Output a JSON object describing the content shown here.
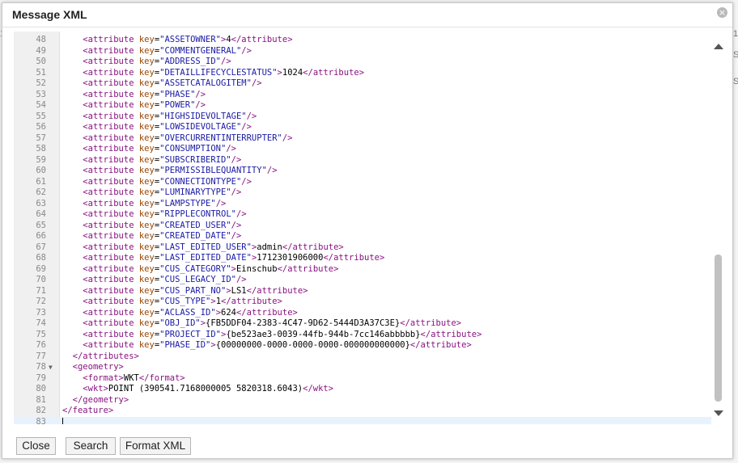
{
  "dialog": {
    "title": "Message XML",
    "close_glyph": "×"
  },
  "background": {
    "left_char_1": "1",
    "right_char_1": "1",
    "right_char_2": "S",
    "right_char_3": "S"
  },
  "editor": {
    "lines": [
      {
        "n": "48",
        "indent": "    ",
        "tag": "attribute",
        "key": "ASSETOWNER",
        "text": "4",
        "selfclose": false
      },
      {
        "n": "49",
        "indent": "    ",
        "tag": "attribute",
        "key": "COMMENTGENERAL",
        "text": "",
        "selfclose": true
      },
      {
        "n": "50",
        "indent": "    ",
        "tag": "attribute",
        "key": "ADDRESS_ID",
        "text": "",
        "selfclose": true
      },
      {
        "n": "51",
        "indent": "    ",
        "tag": "attribute",
        "key": "DETAILLIFECYCLESTATUS",
        "text": "1024",
        "selfclose": false
      },
      {
        "n": "52",
        "indent": "    ",
        "tag": "attribute",
        "key": "ASSETCATALOGITEM",
        "text": "",
        "selfclose": true
      },
      {
        "n": "53",
        "indent": "    ",
        "tag": "attribute",
        "key": "PHASE",
        "text": "",
        "selfclose": true
      },
      {
        "n": "54",
        "indent": "    ",
        "tag": "attribute",
        "key": "POWER",
        "text": "",
        "selfclose": true
      },
      {
        "n": "55",
        "indent": "    ",
        "tag": "attribute",
        "key": "HIGHSIDEVOLTAGE",
        "text": "",
        "selfclose": true
      },
      {
        "n": "56",
        "indent": "    ",
        "tag": "attribute",
        "key": "LOWSIDEVOLTAGE",
        "text": "",
        "selfclose": true
      },
      {
        "n": "57",
        "indent": "    ",
        "tag": "attribute",
        "key": "OVERCURRENTINTERRUPTER",
        "text": "",
        "selfclose": true
      },
      {
        "n": "58",
        "indent": "    ",
        "tag": "attribute",
        "key": "CONSUMPTION",
        "text": "",
        "selfclose": true
      },
      {
        "n": "59",
        "indent": "    ",
        "tag": "attribute",
        "key": "SUBSCRIBERID",
        "text": "",
        "selfclose": true
      },
      {
        "n": "60",
        "indent": "    ",
        "tag": "attribute",
        "key": "PERMISSIBLEQUANTITY",
        "text": "",
        "selfclose": true
      },
      {
        "n": "61",
        "indent": "    ",
        "tag": "attribute",
        "key": "CONNECTIONTYPE",
        "text": "",
        "selfclose": true
      },
      {
        "n": "62",
        "indent": "    ",
        "tag": "attribute",
        "key": "LUMINARYTYPE",
        "text": "",
        "selfclose": true
      },
      {
        "n": "63",
        "indent": "    ",
        "tag": "attribute",
        "key": "LAMPSTYPE",
        "text": "",
        "selfclose": true
      },
      {
        "n": "64",
        "indent": "    ",
        "tag": "attribute",
        "key": "RIPPLECONTROL",
        "text": "",
        "selfclose": true
      },
      {
        "n": "65",
        "indent": "    ",
        "tag": "attribute",
        "key": "CREATED_USER",
        "text": "",
        "selfclose": true
      },
      {
        "n": "66",
        "indent": "    ",
        "tag": "attribute",
        "key": "CREATED_DATE",
        "text": "",
        "selfclose": true
      },
      {
        "n": "67",
        "indent": "    ",
        "tag": "attribute",
        "key": "LAST_EDITED_USER",
        "text": "admin",
        "selfclose": false
      },
      {
        "n": "68",
        "indent": "    ",
        "tag": "attribute",
        "key": "LAST_EDITED_DATE",
        "text": "1712301906000",
        "selfclose": false
      },
      {
        "n": "69",
        "indent": "    ",
        "tag": "attribute",
        "key": "CUS_CATEGORY",
        "text": "Einschub",
        "selfclose": false
      },
      {
        "n": "70",
        "indent": "    ",
        "tag": "attribute",
        "key": "CUS_LEGACY_ID",
        "text": "",
        "selfclose": true
      },
      {
        "n": "71",
        "indent": "    ",
        "tag": "attribute",
        "key": "CUS_PART_NO",
        "text": "LS1",
        "selfclose": false
      },
      {
        "n": "72",
        "indent": "    ",
        "tag": "attribute",
        "key": "CUS_TYPE",
        "text": "1",
        "selfclose": false
      },
      {
        "n": "73",
        "indent": "    ",
        "tag": "attribute",
        "key": "ACLASS_ID",
        "text": "624",
        "selfclose": false
      },
      {
        "n": "74",
        "indent": "    ",
        "tag": "attribute",
        "key": "OBJ_ID",
        "text": "{FB5DDF04-2383-4C47-9D62-5444D3A37C3E}",
        "selfclose": false
      },
      {
        "n": "75",
        "indent": "    ",
        "tag": "attribute",
        "key": "PROJECT_ID",
        "text": "{be523ae3-0039-44fb-944b-7cc146abbbbb}",
        "selfclose": false
      },
      {
        "n": "76",
        "indent": "    ",
        "tag": "attribute",
        "key": "PHASE_ID",
        "text": "{00000000-0000-0000-0000-000000000000}",
        "selfclose": false
      },
      {
        "n": "77",
        "indent": "  ",
        "close": "attributes"
      },
      {
        "n": "78",
        "indent": "  ",
        "open": "geometry",
        "fold": true
      },
      {
        "n": "79",
        "indent": "    ",
        "simple": "format",
        "text": "WKT"
      },
      {
        "n": "80",
        "indent": "    ",
        "simple": "wkt",
        "text": "POINT (390541.7168000005 5820318.6043)"
      },
      {
        "n": "81",
        "indent": "  ",
        "close": "geometry"
      },
      {
        "n": "82",
        "indent": "",
        "close": "feature"
      },
      {
        "n": "83",
        "indent": "",
        "empty": true,
        "active": true
      }
    ]
  },
  "buttons": {
    "close": "Close",
    "search": "Search",
    "format": "Format XML"
  },
  "colors": {
    "tag": "#881280",
    "attr": "#994500",
    "value": "#1a1aa6"
  }
}
